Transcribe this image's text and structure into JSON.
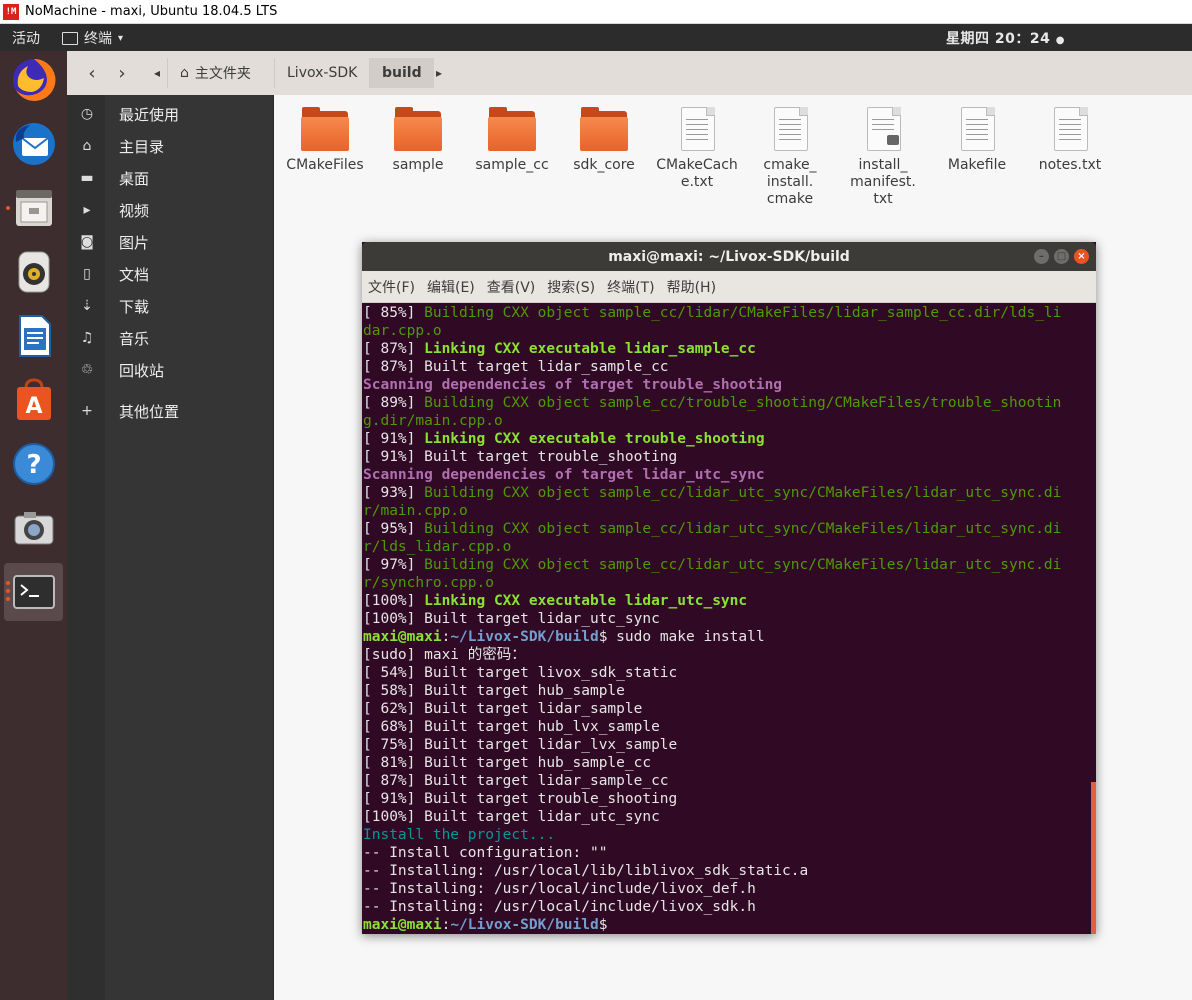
{
  "nomachine": {
    "logo": "!M",
    "title": "NoMachine - maxi, Ubuntu 18.04.5 LTS"
  },
  "topbar": {
    "activities": "活动",
    "app_menu": "终端",
    "clock": "星期四 20：24"
  },
  "dock": {
    "items": [
      {
        "name": "firefox-icon"
      },
      {
        "name": "thunderbird-icon"
      },
      {
        "name": "files-icon"
      },
      {
        "name": "rhythmbox-icon"
      },
      {
        "name": "writer-icon"
      },
      {
        "name": "software-icon"
      },
      {
        "name": "help-icon"
      },
      {
        "name": "screenshot-icon"
      },
      {
        "name": "terminal-icon"
      }
    ],
    "colors": {
      "accent": "#e95420"
    }
  },
  "files": {
    "breadcrumb": {
      "home": "主文件夹",
      "parent": "Livox-SDK",
      "current": "build"
    },
    "sidebar": [
      {
        "icon": "clock-icon",
        "label": "最近使用"
      },
      {
        "icon": "home-icon",
        "label": "主目录"
      },
      {
        "icon": "folder-icon",
        "label": "桌面"
      },
      {
        "icon": "video-icon",
        "label": "视频"
      },
      {
        "icon": "camera-icon",
        "label": "图片"
      },
      {
        "icon": "document-icon",
        "label": "文档"
      },
      {
        "icon": "download-icon",
        "label": "下载"
      },
      {
        "icon": "music-icon",
        "label": "音乐"
      },
      {
        "icon": "trash-icon",
        "label": "回收站"
      },
      {
        "icon": "plus-icon",
        "label": "其他位置"
      }
    ],
    "items": [
      {
        "type": "folder",
        "l1": "CMakeFiles",
        "l2": "",
        "l3": ""
      },
      {
        "type": "folder",
        "l1": "sample",
        "l2": "",
        "l3": ""
      },
      {
        "type": "folder",
        "l1": "sample_cc",
        "l2": "",
        "l3": ""
      },
      {
        "type": "folder",
        "l1": "sdk_core",
        "l2": "",
        "l3": ""
      },
      {
        "type": "file",
        "l1": "CMakeCach",
        "l2": "e.txt",
        "l3": ""
      },
      {
        "type": "file",
        "l1": "cmake_",
        "l2": "install.",
        "l3": "cmake"
      },
      {
        "type": "file-locked",
        "l1": "install_",
        "l2": "manifest.",
        "l3": "txt"
      },
      {
        "type": "file",
        "l1": "Makefile",
        "l2": "",
        "l3": ""
      },
      {
        "type": "file",
        "l1": "notes.txt",
        "l2": "",
        "l3": ""
      }
    ]
  },
  "terminal": {
    "title": "maxi@maxi: ~/Livox-SDK/build",
    "menu": [
      "文件(F)",
      "编辑(E)",
      "查看(V)",
      "搜索(S)",
      "终端(T)",
      "帮助(H)"
    ],
    "lines": [
      {
        "a": "[ 85%] ",
        "b": "Building CXX object sample_cc/lidar/CMakeFiles/lidar_sample_cc.dir/lds_li",
        "ca": "",
        "cb": "g"
      },
      {
        "a": "",
        "b": "dar.cpp.o",
        "ca": "",
        "cb": "g"
      },
      {
        "a": "[ 87%] ",
        "b": "Linking CXX executable lidar_sample_cc",
        "ca": "",
        "cb": "gb"
      },
      {
        "a": "[ 87%] Built target lidar_sample_cc",
        "b": "",
        "ca": "",
        "cb": ""
      },
      {
        "a": "",
        "b": "Scanning dependencies of target trouble_shooting",
        "ca": "",
        "cb": "mg"
      },
      {
        "a": "[ 89%] ",
        "b": "Building CXX object sample_cc/trouble_shooting/CMakeFiles/trouble_shootin",
        "ca": "",
        "cb": "g"
      },
      {
        "a": "",
        "b": "g.dir/main.cpp.o",
        "ca": "",
        "cb": "g"
      },
      {
        "a": "[ 91%] ",
        "b": "Linking CXX executable trouble_shooting",
        "ca": "",
        "cb": "gb"
      },
      {
        "a": "[ 91%] Built target trouble_shooting",
        "b": "",
        "ca": "",
        "cb": ""
      },
      {
        "a": "",
        "b": "Scanning dependencies of target lidar_utc_sync",
        "ca": "",
        "cb": "mg"
      },
      {
        "a": "[ 93%] ",
        "b": "Building CXX object sample_cc/lidar_utc_sync/CMakeFiles/lidar_utc_sync.di",
        "ca": "",
        "cb": "g"
      },
      {
        "a": "",
        "b": "r/main.cpp.o",
        "ca": "",
        "cb": "g"
      },
      {
        "a": "[ 95%] ",
        "b": "Building CXX object sample_cc/lidar_utc_sync/CMakeFiles/lidar_utc_sync.di",
        "ca": "",
        "cb": "g"
      },
      {
        "a": "",
        "b": "r/lds_lidar.cpp.o",
        "ca": "",
        "cb": "g"
      },
      {
        "a": "[ 97%] ",
        "b": "Building CXX object sample_cc/lidar_utc_sync/CMakeFiles/lidar_utc_sync.di",
        "ca": "",
        "cb": "g"
      },
      {
        "a": "",
        "b": "r/synchro.cpp.o",
        "ca": "",
        "cb": "g"
      },
      {
        "a": "[100%] ",
        "b": "Linking CXX executable lidar_utc_sync",
        "ca": "",
        "cb": "gb"
      },
      {
        "a": "[100%] Built target lidar_utc_sync",
        "b": "",
        "ca": "",
        "cb": ""
      },
      {
        "a": "maxi@maxi",
        "b": ":",
        "c": "~/Livox-SDK/build",
        "d": "$ sudo make install",
        "prompt": true
      },
      {
        "a": "[sudo] maxi 的密码：",
        "b": "",
        "ca": "",
        "cb": ""
      },
      {
        "a": "[ 54%] Built target livox_sdk_static",
        "b": "",
        "ca": "",
        "cb": ""
      },
      {
        "a": "[ 58%] Built target hub_sample",
        "b": "",
        "ca": "",
        "cb": ""
      },
      {
        "a": "[ 62%] Built target lidar_sample",
        "b": "",
        "ca": "",
        "cb": ""
      },
      {
        "a": "[ 68%] Built target hub_lvx_sample",
        "b": "",
        "ca": "",
        "cb": ""
      },
      {
        "a": "[ 75%] Built target lidar_lvx_sample",
        "b": "",
        "ca": "",
        "cb": ""
      },
      {
        "a": "[ 81%] Built target hub_sample_cc",
        "b": "",
        "ca": "",
        "cb": ""
      },
      {
        "a": "[ 87%] Built target lidar_sample_cc",
        "b": "",
        "ca": "",
        "cb": ""
      },
      {
        "a": "[ 91%] Built target trouble_shooting",
        "b": "",
        "ca": "",
        "cb": ""
      },
      {
        "a": "[100%] Built target lidar_utc_sync",
        "b": "",
        "ca": "",
        "cb": ""
      },
      {
        "a": "",
        "b": "Install the project...",
        "ca": "",
        "cb": "cy"
      },
      {
        "a": "-- Install configuration: \"\"",
        "b": "",
        "ca": "",
        "cb": ""
      },
      {
        "a": "-- Installing: /usr/local/lib/liblivox_sdk_static.a",
        "b": "",
        "ca": "",
        "cb": ""
      },
      {
        "a": "-- Installing: /usr/local/include/livox_def.h",
        "b": "",
        "ca": "",
        "cb": ""
      },
      {
        "a": "-- Installing: /usr/local/include/livox_sdk.h",
        "b": "",
        "ca": "",
        "cb": ""
      },
      {
        "a": "maxi@maxi",
        "b": ":",
        "c": "~/Livox-SDK/build",
        "d": "$",
        "prompt": true
      }
    ]
  }
}
